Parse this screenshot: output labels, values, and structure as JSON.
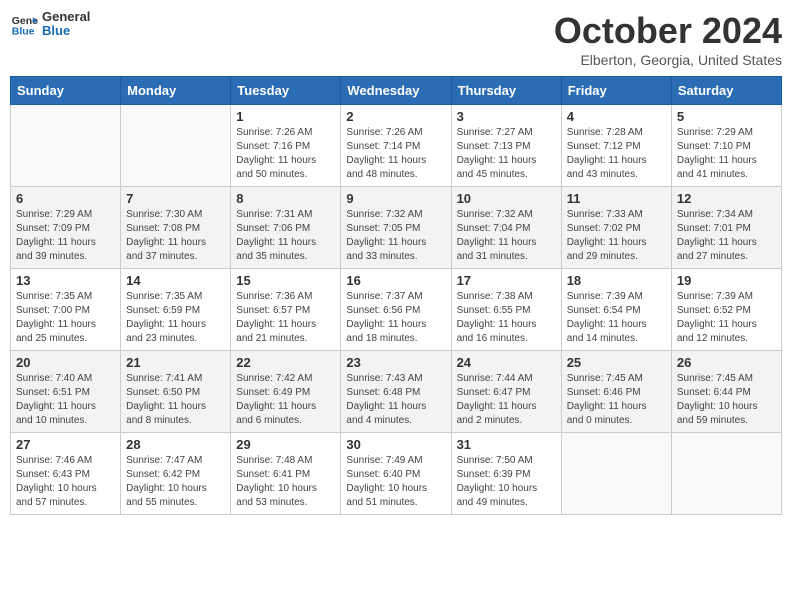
{
  "logo": {
    "text_general": "General",
    "text_blue": "Blue"
  },
  "header": {
    "month": "October 2024",
    "location": "Elberton, Georgia, United States"
  },
  "weekdays": [
    "Sunday",
    "Monday",
    "Tuesday",
    "Wednesday",
    "Thursday",
    "Friday",
    "Saturday"
  ],
  "weeks": [
    [
      {
        "day": "",
        "sunrise": "",
        "sunset": "",
        "daylight": ""
      },
      {
        "day": "",
        "sunrise": "",
        "sunset": "",
        "daylight": ""
      },
      {
        "day": "1",
        "sunrise": "Sunrise: 7:26 AM",
        "sunset": "Sunset: 7:16 PM",
        "daylight": "Daylight: 11 hours and 50 minutes."
      },
      {
        "day": "2",
        "sunrise": "Sunrise: 7:26 AM",
        "sunset": "Sunset: 7:14 PM",
        "daylight": "Daylight: 11 hours and 48 minutes."
      },
      {
        "day": "3",
        "sunrise": "Sunrise: 7:27 AM",
        "sunset": "Sunset: 7:13 PM",
        "daylight": "Daylight: 11 hours and 45 minutes."
      },
      {
        "day": "4",
        "sunrise": "Sunrise: 7:28 AM",
        "sunset": "Sunset: 7:12 PM",
        "daylight": "Daylight: 11 hours and 43 minutes."
      },
      {
        "day": "5",
        "sunrise": "Sunrise: 7:29 AM",
        "sunset": "Sunset: 7:10 PM",
        "daylight": "Daylight: 11 hours and 41 minutes."
      }
    ],
    [
      {
        "day": "6",
        "sunrise": "Sunrise: 7:29 AM",
        "sunset": "Sunset: 7:09 PM",
        "daylight": "Daylight: 11 hours and 39 minutes."
      },
      {
        "day": "7",
        "sunrise": "Sunrise: 7:30 AM",
        "sunset": "Sunset: 7:08 PM",
        "daylight": "Daylight: 11 hours and 37 minutes."
      },
      {
        "day": "8",
        "sunrise": "Sunrise: 7:31 AM",
        "sunset": "Sunset: 7:06 PM",
        "daylight": "Daylight: 11 hours and 35 minutes."
      },
      {
        "day": "9",
        "sunrise": "Sunrise: 7:32 AM",
        "sunset": "Sunset: 7:05 PM",
        "daylight": "Daylight: 11 hours and 33 minutes."
      },
      {
        "day": "10",
        "sunrise": "Sunrise: 7:32 AM",
        "sunset": "Sunset: 7:04 PM",
        "daylight": "Daylight: 11 hours and 31 minutes."
      },
      {
        "day": "11",
        "sunrise": "Sunrise: 7:33 AM",
        "sunset": "Sunset: 7:02 PM",
        "daylight": "Daylight: 11 hours and 29 minutes."
      },
      {
        "day": "12",
        "sunrise": "Sunrise: 7:34 AM",
        "sunset": "Sunset: 7:01 PM",
        "daylight": "Daylight: 11 hours and 27 minutes."
      }
    ],
    [
      {
        "day": "13",
        "sunrise": "Sunrise: 7:35 AM",
        "sunset": "Sunset: 7:00 PM",
        "daylight": "Daylight: 11 hours and 25 minutes."
      },
      {
        "day": "14",
        "sunrise": "Sunrise: 7:35 AM",
        "sunset": "Sunset: 6:59 PM",
        "daylight": "Daylight: 11 hours and 23 minutes."
      },
      {
        "day": "15",
        "sunrise": "Sunrise: 7:36 AM",
        "sunset": "Sunset: 6:57 PM",
        "daylight": "Daylight: 11 hours and 21 minutes."
      },
      {
        "day": "16",
        "sunrise": "Sunrise: 7:37 AM",
        "sunset": "Sunset: 6:56 PM",
        "daylight": "Daylight: 11 hours and 18 minutes."
      },
      {
        "day": "17",
        "sunrise": "Sunrise: 7:38 AM",
        "sunset": "Sunset: 6:55 PM",
        "daylight": "Daylight: 11 hours and 16 minutes."
      },
      {
        "day": "18",
        "sunrise": "Sunrise: 7:39 AM",
        "sunset": "Sunset: 6:54 PM",
        "daylight": "Daylight: 11 hours and 14 minutes."
      },
      {
        "day": "19",
        "sunrise": "Sunrise: 7:39 AM",
        "sunset": "Sunset: 6:52 PM",
        "daylight": "Daylight: 11 hours and 12 minutes."
      }
    ],
    [
      {
        "day": "20",
        "sunrise": "Sunrise: 7:40 AM",
        "sunset": "Sunset: 6:51 PM",
        "daylight": "Daylight: 11 hours and 10 minutes."
      },
      {
        "day": "21",
        "sunrise": "Sunrise: 7:41 AM",
        "sunset": "Sunset: 6:50 PM",
        "daylight": "Daylight: 11 hours and 8 minutes."
      },
      {
        "day": "22",
        "sunrise": "Sunrise: 7:42 AM",
        "sunset": "Sunset: 6:49 PM",
        "daylight": "Daylight: 11 hours and 6 minutes."
      },
      {
        "day": "23",
        "sunrise": "Sunrise: 7:43 AM",
        "sunset": "Sunset: 6:48 PM",
        "daylight": "Daylight: 11 hours and 4 minutes."
      },
      {
        "day": "24",
        "sunrise": "Sunrise: 7:44 AM",
        "sunset": "Sunset: 6:47 PM",
        "daylight": "Daylight: 11 hours and 2 minutes."
      },
      {
        "day": "25",
        "sunrise": "Sunrise: 7:45 AM",
        "sunset": "Sunset: 6:46 PM",
        "daylight": "Daylight: 11 hours and 0 minutes."
      },
      {
        "day": "26",
        "sunrise": "Sunrise: 7:45 AM",
        "sunset": "Sunset: 6:44 PM",
        "daylight": "Daylight: 10 hours and 59 minutes."
      }
    ],
    [
      {
        "day": "27",
        "sunrise": "Sunrise: 7:46 AM",
        "sunset": "Sunset: 6:43 PM",
        "daylight": "Daylight: 10 hours and 57 minutes."
      },
      {
        "day": "28",
        "sunrise": "Sunrise: 7:47 AM",
        "sunset": "Sunset: 6:42 PM",
        "daylight": "Daylight: 10 hours and 55 minutes."
      },
      {
        "day": "29",
        "sunrise": "Sunrise: 7:48 AM",
        "sunset": "Sunset: 6:41 PM",
        "daylight": "Daylight: 10 hours and 53 minutes."
      },
      {
        "day": "30",
        "sunrise": "Sunrise: 7:49 AM",
        "sunset": "Sunset: 6:40 PM",
        "daylight": "Daylight: 10 hours and 51 minutes."
      },
      {
        "day": "31",
        "sunrise": "Sunrise: 7:50 AM",
        "sunset": "Sunset: 6:39 PM",
        "daylight": "Daylight: 10 hours and 49 minutes."
      },
      {
        "day": "",
        "sunrise": "",
        "sunset": "",
        "daylight": ""
      },
      {
        "day": "",
        "sunrise": "",
        "sunset": "",
        "daylight": ""
      }
    ]
  ]
}
